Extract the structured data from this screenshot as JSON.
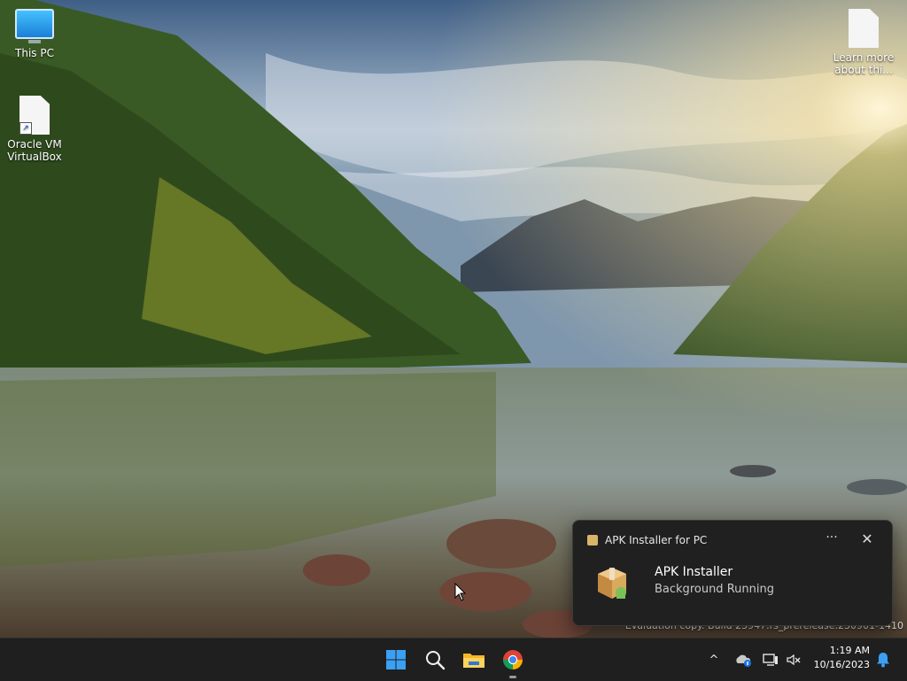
{
  "desktop": {
    "icons": [
      {
        "label": "This PC",
        "icon": "this-pc-icon"
      },
      {
        "label": "Oracle VM VirtualBox",
        "icon": "virtualbox-shortcut-icon"
      },
      {
        "label": "Learn more about thi...",
        "icon": "document-icon"
      }
    ],
    "watermark": "Evaluation copy. Build 25947.rs_prerelease.230901-1410"
  },
  "notification": {
    "app_name": "APK Installer for PC",
    "title": "APK Installer",
    "text": "Background Running",
    "more_label": "···",
    "close_label": "✕"
  },
  "taskbar": {
    "apps": [
      {
        "name": "start-button",
        "icon": "windows-logo-icon"
      },
      {
        "name": "search-button",
        "icon": "search-icon"
      },
      {
        "name": "file-explorer-button",
        "icon": "folder-icon"
      },
      {
        "name": "chrome-button",
        "icon": "chrome-icon"
      }
    ],
    "tray": {
      "chevron": "^"
    },
    "clock": {
      "time": "1:19 AM",
      "date": "10/16/2023"
    }
  },
  "colors": {
    "taskbar_bg": "#1f1f1f",
    "toast_bg": "#202020",
    "accent": "#0078d4"
  }
}
